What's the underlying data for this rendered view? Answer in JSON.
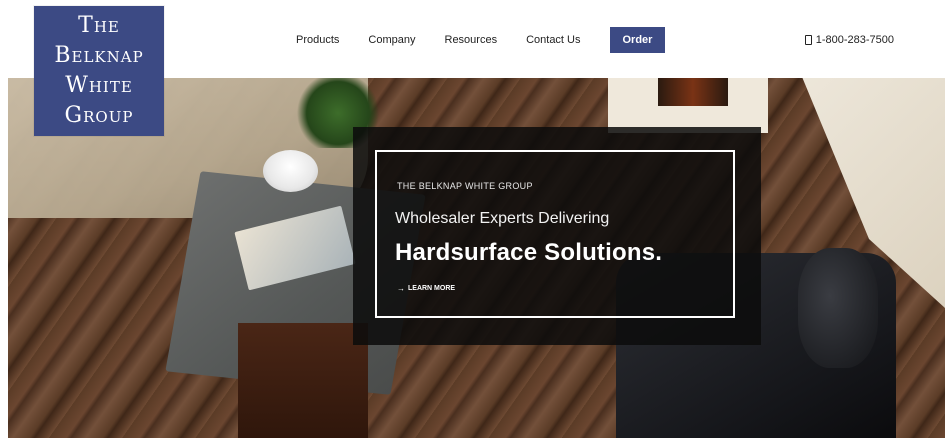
{
  "logo": {
    "lines": [
      "The",
      "Belknap",
      "White",
      "Group"
    ],
    "bg_color": "#3c4a84"
  },
  "nav": {
    "items": [
      {
        "label": "Products"
      },
      {
        "label": "Company"
      },
      {
        "label": "Resources"
      },
      {
        "label": "Contact Us"
      }
    ],
    "order_label": "Order"
  },
  "contact": {
    "phone": "1-800-283-7500",
    "phone_icon": "phone-icon"
  },
  "hero": {
    "kicker": "THE BELKNAP WHITE GROUP",
    "headline_line1": "Wholesaler Experts Delivering",
    "headline_line2": "Hardsurface Solutions.",
    "cta_label": "LEARN MORE",
    "cta_icon": "arrow-right-icon"
  },
  "colors": {
    "brand": "#3c4a84",
    "overlay": "#0c0c0c",
    "text_dark": "#222222"
  }
}
